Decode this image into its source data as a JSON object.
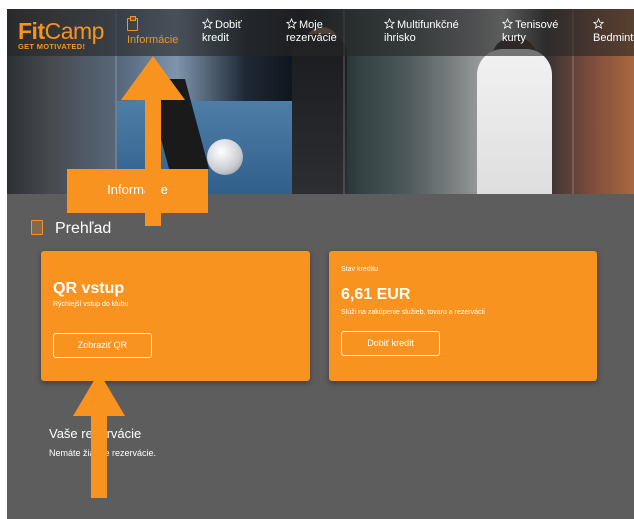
{
  "brand": {
    "logo_fit": "Fit",
    "logo_camp": "Camp",
    "tagline": "GET MOTIVATED!",
    "accent": "#f7931e"
  },
  "nav": {
    "items": [
      {
        "icon": "clipboard-icon",
        "line1": "",
        "line2": "Informácie",
        "active": true
      },
      {
        "icon": "star-icon",
        "line1": "Dobiť",
        "line2": "kredit"
      },
      {
        "icon": "star-icon",
        "line1": "Moje",
        "line2": "rezervácie"
      },
      {
        "icon": "star-icon",
        "line1": "Multifunkčné",
        "line2": "ihrisko"
      },
      {
        "icon": "star-icon",
        "line1": "Tenisové",
        "line2": "kurty"
      },
      {
        "icon": "star-icon",
        "line1": "",
        "line2": "Bedminton"
      }
    ]
  },
  "tooltip": {
    "text": "Informácie"
  },
  "overview": {
    "title": "Prehľad"
  },
  "qr_card": {
    "title": "QR vstup",
    "subtitle": "Rýchlejší vstup do klubu",
    "button": "Zobraziť QR"
  },
  "credit_card": {
    "label": "Stav kreditu",
    "amount": "6,61 EUR",
    "note": "Slúži na zakúpenie služieb, tovaru a rezervácií",
    "button": "Dobiť kredit"
  },
  "reservations": {
    "title": "Vaše rezervácie",
    "empty_text": "Nemáte žiadne rezervácie."
  }
}
